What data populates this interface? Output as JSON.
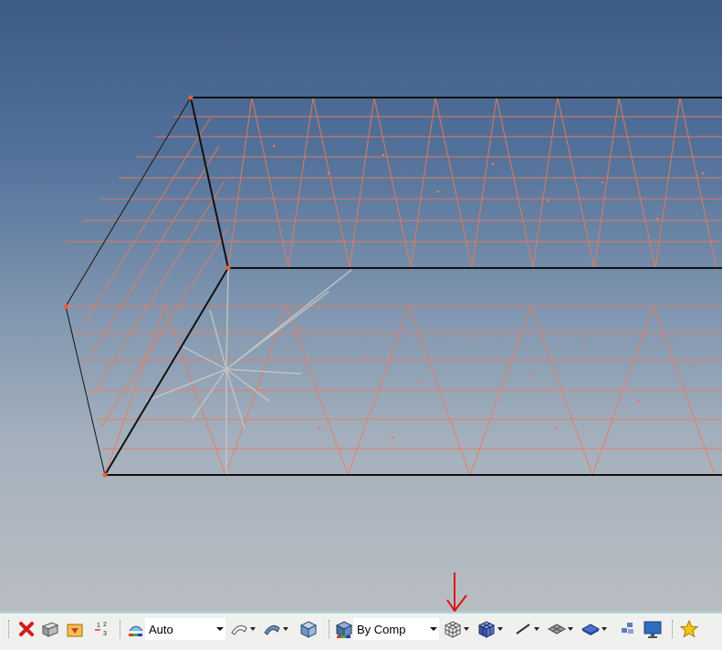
{
  "toolbar": {
    "color_mode_combo": {
      "value": "Auto"
    },
    "display_by_combo": {
      "value": "By Comp"
    }
  },
  "icons": {
    "delete": "red-x-icon",
    "components": "components-icon",
    "mask": "mask-icon",
    "numbering": "numbering-icon",
    "color_mode": "color-mode-icon",
    "surface_curve": "surface-curve-icon",
    "surface_shaded": "surface-shaded-icon",
    "solid": "solid-cube-icon",
    "by_comp": "by-comp-cube-icon",
    "wireframe_elements": "wireframe-cube-icon",
    "shaded_elements": "shaded-elements-cube-icon",
    "line": "line-icon",
    "feature_edges": "feature-edges-icon",
    "shaded_plane": "shaded-plane-icon",
    "element_cluster": "element-cluster-icon",
    "monitor": "monitor-icon",
    "favorite": "star-icon"
  },
  "colors": {
    "viewport_top": "#3d5c85",
    "viewport_bottom": "#b8bdc2",
    "mesh": "#f07a55",
    "edge": "#111111",
    "toolbar_bg": "#f0f0ee",
    "annotation_arrow": "#e01010"
  }
}
